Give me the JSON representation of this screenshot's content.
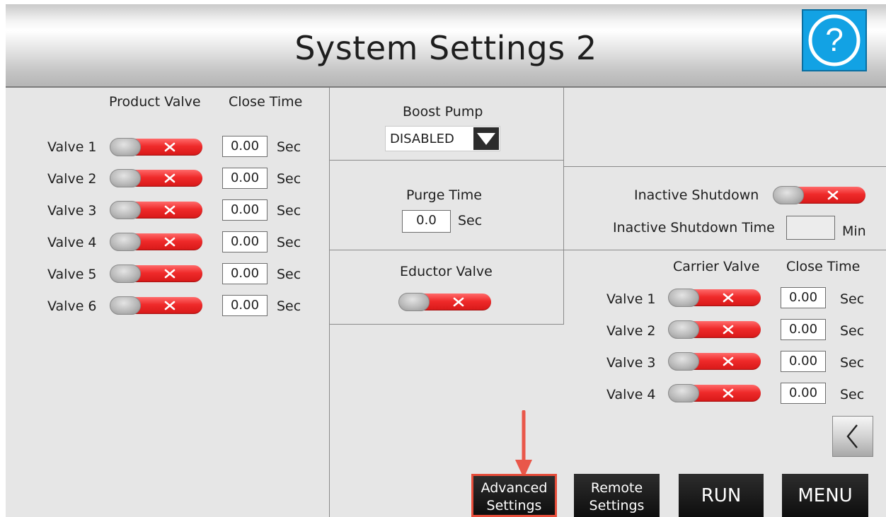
{
  "header": {
    "title": "System Settings 2",
    "help_glyph": "?"
  },
  "product_valves": {
    "col_valve": "Product Valve",
    "col_close": "Close Time",
    "unit": "Sec",
    "rows": [
      {
        "label": "Valve 1",
        "value": "0.00",
        "state": "off"
      },
      {
        "label": "Valve 2",
        "value": "0.00",
        "state": "off"
      },
      {
        "label": "Valve 3",
        "value": "0.00",
        "state": "off"
      },
      {
        "label": "Valve 4",
        "value": "0.00",
        "state": "off"
      },
      {
        "label": "Valve 5",
        "value": "0.00",
        "state": "off"
      },
      {
        "label": "Valve 6",
        "value": "0.00",
        "state": "off"
      }
    ]
  },
  "boost_pump": {
    "label": "Boost Pump",
    "selected": "DISABLED"
  },
  "purge_time": {
    "label": "Purge Time",
    "value": "0.0",
    "unit": "Sec"
  },
  "eductor_valve": {
    "label": "Eductor Valve",
    "state": "off"
  },
  "inactive": {
    "shutdown_label": "Inactive Shutdown",
    "shutdown_state": "off",
    "time_label": "Inactive Shutdown Time",
    "time_value": "",
    "unit": "Min"
  },
  "carrier_valves": {
    "col_valve": "Carrier Valve",
    "col_close": "Close Time",
    "unit": "Sec",
    "rows": [
      {
        "label": "Valve 1",
        "value": "0.00",
        "state": "off"
      },
      {
        "label": "Valve 2",
        "value": "0.00",
        "state": "off"
      },
      {
        "label": "Valve 3",
        "value": "0.00",
        "state": "off"
      },
      {
        "label": "Valve 4",
        "value": "0.00",
        "state": "off"
      }
    ]
  },
  "nav": {
    "back_glyph": "<",
    "advanced_line1": "Advanced",
    "advanced_line2": "Settings",
    "remote_line1": "Remote",
    "remote_line2": "Settings",
    "run": "RUN",
    "menu": "MENU"
  },
  "colors": {
    "toggle_off": "#e8262a",
    "help_button": "#12a2e4",
    "highlight_border": "#e64d3a",
    "annotation_arrow": "#e9574a",
    "panel_bg": "#e6e6e6"
  },
  "icons": {
    "help": "question-circle-icon",
    "dropdown": "triangle-down-icon",
    "back": "chevron-left-icon",
    "toggle_off": "x-icon"
  }
}
